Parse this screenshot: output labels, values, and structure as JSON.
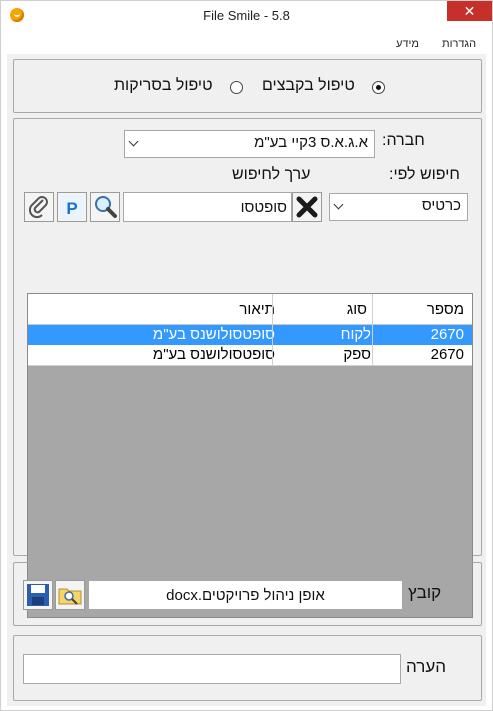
{
  "window": {
    "title": "File Smile - 5.8",
    "close_glyph": "✕"
  },
  "menu": {
    "settings": "הגדרות",
    "info": "מידע"
  },
  "mode": {
    "files": "טיפול בקבצים",
    "scans": "טיפול בסריקות"
  },
  "search": {
    "company_label": "חברה:",
    "company_value": "א.ג.א.ס 3קיי בע\"מ",
    "search_by_label": "חיפוש לפי:",
    "search_value_label": "ערך לחיפוש",
    "search_by_value": "כרטיס",
    "search_input_value": "סופטסו"
  },
  "results": {
    "columns": {
      "number": "מספר",
      "type": "סוג",
      "description": "תיאור"
    },
    "rows": [
      {
        "number": "2670",
        "type": "לקוח",
        "description": "סופטסולושנס בע\"מ"
      },
      {
        "number": "2670",
        "type": "ספק",
        "description": "סופטסולושנס בע\"מ"
      }
    ]
  },
  "file": {
    "label": "קובץ",
    "value": "אופן ניהול פרויקטים.docx"
  },
  "note": {
    "label": "הערה",
    "value": ""
  }
}
